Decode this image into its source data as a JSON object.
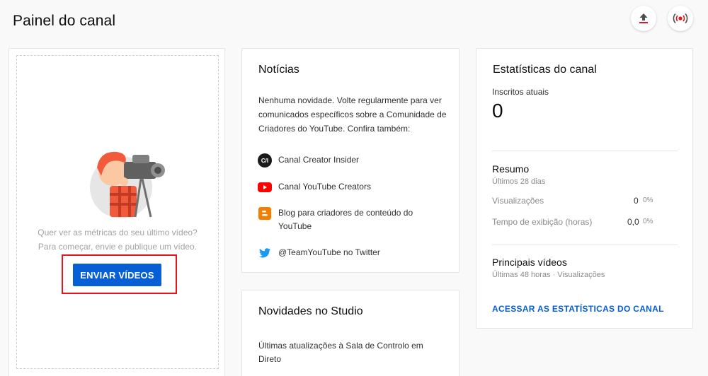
{
  "page": {
    "title": "Painel do canal"
  },
  "header_actions": {
    "upload_icon": "upload-icon",
    "live_icon": "live-broadcast-icon"
  },
  "latest_video": {
    "illustration": "videographer-illustration",
    "message_line1": "Quer ver as métricas do seu último vídeo?",
    "message_line2": "Para começar, envie e publique um vídeo.",
    "upload_button": "ENVIAR VÍDEOS"
  },
  "news": {
    "title": "Notícias",
    "body": "Nenhuma novidade. Volte regularmente para ver comunicados específicos sobre a Comunidade de Criadores do YouTube. Confira também:",
    "links": [
      {
        "label": "Canal Creator Insider",
        "icon": "creator-insider-icon"
      },
      {
        "label": "Canal YouTube Creators",
        "icon": "youtube-icon"
      },
      {
        "label": "Blog para criadores de conteúdo do YouTube",
        "icon": "blogger-icon"
      },
      {
        "label": "@TeamYouTube no Twitter",
        "icon": "twitter-icon"
      }
    ]
  },
  "studio": {
    "title": "Novidades no Studio",
    "body": "Últimas atualizações à Sala de Controlo em Direto"
  },
  "stats": {
    "title": "Estatísticas do canal",
    "subscribers_label": "Inscritos atuais",
    "subscribers_value": "0",
    "summary_title": "Resumo",
    "summary_period": "Últimos 28 dias",
    "metrics": [
      {
        "label": "Visualizações",
        "value": "0",
        "pct": "0%"
      },
      {
        "label": "Tempo de exibição (horas)",
        "value": "0,0",
        "pct": "0%"
      }
    ],
    "top_videos_title": "Principais vídeos",
    "top_videos_sub": "Últimas 48 horas · Visualizações",
    "link": "ACESSAR AS ESTATÍSTICAS DO CANAL"
  },
  "colors": {
    "accent": "#065fd4",
    "highlight": "#e8131f",
    "youtube_red": "#ff0000",
    "blogger": "#f57d00",
    "twitter": "#1d9bf0"
  }
}
